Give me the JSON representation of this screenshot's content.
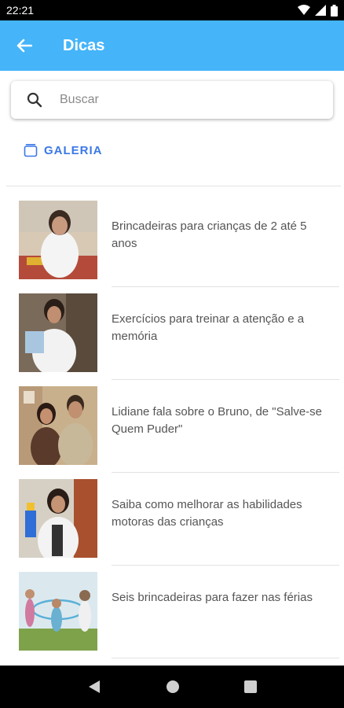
{
  "status_bar": {
    "time": "22:21"
  },
  "app_bar": {
    "title": "Dicas"
  },
  "search": {
    "placeholder": "Buscar",
    "value": ""
  },
  "gallery": {
    "label": "GALERIA"
  },
  "items": [
    {
      "title": "Brincadeiras para crianças de 2 até 5 anos"
    },
    {
      "title": "Exercícios para treinar a atenção e a memória"
    },
    {
      "title": "Lidiane fala sobre o Bruno, de \"Salve-se Quem Puder\""
    },
    {
      "title": "Saiba como melhorar as habilidades motoras das crianças"
    },
    {
      "title": "Seis brincadeiras para fazer nas férias"
    }
  ],
  "colors": {
    "app_bar": "#45b4f8",
    "accent": "#3b78e7"
  },
  "icons": [
    "wifi-icon",
    "signal-icon",
    "battery-icon",
    "back-arrow-icon",
    "search-icon",
    "gallery-icon",
    "nav-back-icon",
    "nav-home-icon",
    "nav-recents-icon"
  ]
}
